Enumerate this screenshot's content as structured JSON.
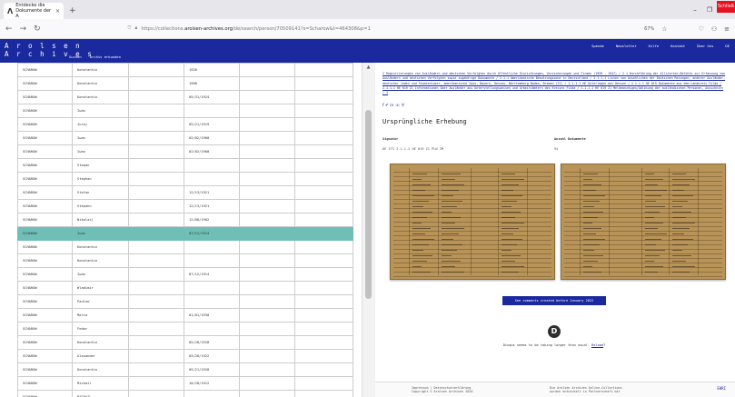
{
  "browser": {
    "tab_title": "Entdecke die Dokumente der A",
    "tab_icon": "arolsen-icon",
    "url_prefix": "https://collections.",
    "url_host": "arolsen-archives.org",
    "url_path": "/de/search/person/70509141?s=Scharow&t=464308&p=1",
    "zoom": "67%",
    "close_label": "Schließ"
  },
  "site": {
    "logo_line1": "A r o l s e n",
    "logo_line2": "A r c h i v e s",
    "nav": [
      "Suchen",
      "Archiv erkunden"
    ],
    "nav_right": [
      "Spende",
      "Newsletter",
      "Hilfe",
      "Kontakt",
      "Über Uns",
      "DE"
    ]
  },
  "table": {
    "rows": [
      {
        "last": "SCHAROW",
        "first": "Konstantin",
        "c3": "",
        "c4": "1920",
        "c5": ""
      },
      {
        "last": "SCHAROW",
        "first": "Konstantin",
        "c3": "",
        "c4": "1908",
        "c5": ""
      },
      {
        "last": "SCHAROW",
        "first": "Konstantin",
        "c3": "",
        "c4": "05/31/1924",
        "c5": ""
      },
      {
        "last": "SCHAROW",
        "first": "Iwan",
        "c3": "",
        "c4": "",
        "c5": ""
      },
      {
        "last": "SCHAROW",
        "first": "Juraj",
        "c3": "",
        "c4": "05/21/1919",
        "c5": ""
      },
      {
        "last": "SCHAROW",
        "first": "Iwan",
        "c3": "",
        "c4": "02/02/1900",
        "c5": ""
      },
      {
        "last": "SCHAROW",
        "first": "Iwan",
        "c3": "",
        "c4": "02/02/1900",
        "c5": ""
      },
      {
        "last": "SCHAROW",
        "first": "Stepan",
        "c3": "",
        "c4": "",
        "c5": ""
      },
      {
        "last": "SCHAROW",
        "first": "Stephan",
        "c3": "",
        "c4": "",
        "c5": ""
      },
      {
        "last": "SCHAROW",
        "first": "Stefan",
        "c3": "",
        "c4": "12/13/1921",
        "c5": ""
      },
      {
        "last": "SCHAROW",
        "first": "Stepahn",
        "c3": "",
        "c4": "12/13/1921",
        "c5": ""
      },
      {
        "last": "SCHAROW",
        "first": "Nikolaij",
        "c3": "",
        "c4": "12/08/1902",
        "c5": ""
      },
      {
        "last": "SCHAROW",
        "first": "Iwan",
        "c3": "",
        "c4": "07/12/1914",
        "c5": "",
        "selected": true
      },
      {
        "last": "SCHAROW",
        "first": "Konstantin",
        "c3": "",
        "c4": "",
        "c5": ""
      },
      {
        "last": "SCHAROW",
        "first": "Konstantin",
        "c3": "",
        "c4": "",
        "c5": ""
      },
      {
        "last": "SCHAROW",
        "first": "Iwan",
        "c3": "",
        "c4": "07/12/1914",
        "c5": ""
      },
      {
        "last": "SCHAROW",
        "first": "Wladimir",
        "c3": "",
        "c4": "",
        "c5": ""
      },
      {
        "last": "SCHAROW",
        "first": "Paulow",
        "c3": "",
        "c4": "",
        "c5": ""
      },
      {
        "last": "SCHAROW",
        "first": "Maria",
        "c3": "",
        "c4": "01/01/1930",
        "c5": ""
      },
      {
        "last": "SCHAROW",
        "first": "Fedor",
        "c3": "",
        "c4": "",
        "c5": ""
      },
      {
        "last": "SCHAROW",
        "first": "Konstantin",
        "c3": "",
        "c4": "05/28/1928",
        "c5": ""
      },
      {
        "last": "SCHAROW",
        "first": "Alexander",
        "c3": "",
        "c4": "03/28/1922",
        "c5": ""
      },
      {
        "last": "SCHAROW",
        "first": "Konstantin",
        "c3": "",
        "c4": "05/21/1928",
        "c5": ""
      },
      {
        "last": "SCHAROW",
        "first": "Michail",
        "c3": "",
        "c4": "10/28/1912",
        "c5": ""
      },
      {
        "last": "SCHAROW",
        "first": "MICHAIL",
        "c3": "",
        "c4": "",
        "c5": ""
      }
    ]
  },
  "detail": {
    "breadcrumbs": "2 Registrierungen von Ausländern und deutschen Verfolgten durch öffentliche Einrichtungen, Versicherungen und Firmen (1939 - 1947) / 2.1 Durchführung der Alliierten-Befehle zur Erfassung von Ausländern und deutschen Verfolgten sowie zugehörige Dokumente / 2.1.1 Amerikanische Besatzungszone in Deutschland / 2.1.1.1 Listen von Ansehlichen der Deutschen Reisegen, anderer Ausländer, deutscher Juden und Staatenloser, amerikanische Zone, Bayern, Hessen, Württemberg-Baden, Bremen (II) / 2.1.1.1 HE Unterlagen aus Hessen / 2.1.1.1 HE 019 Dokumente aus dem Landkreis Fulda / 2.1.1.1 HE 019 Z1 Informationen über Ausländer aus Unterstellungsweisen und Arbeitsämtern des Kreises Fulda / 2.1.1.1 HE 019 Z1 Meldeanzeigen/Ablösung der ausländischen Personen, Ausschnitt / 1",
    "social_icons": "f ✔ in ☏ ⚲",
    "section_title": "Ursprüngliche Erhebung",
    "signatur_label": "Signatur",
    "signatur_value": "DE ITS 2.1.1.2 HE 019 Z1 PLN ZM",
    "anzahl_label": "Anzahl Dokumente",
    "anzahl_value": "94",
    "comments_button": "See comments created before January 2022",
    "disqus_message": "Disqus seems to be taking longer than usual.",
    "disqus_reload": "Reload",
    "footer_left_1": "Impressum  |  Datenschutzerklärung",
    "footer_left_2": "Copyright © Arolsen Archives 2020",
    "footer_right_1": "Die Arolsen Archives Online-Collections",
    "footer_right_2": "wurden entwickelt in Partnerschaft mit",
    "footer_logo": "EHRI"
  },
  "colors": {
    "brand_blue": "#1a2a9e",
    "selected_row": "#6fbfb6"
  }
}
